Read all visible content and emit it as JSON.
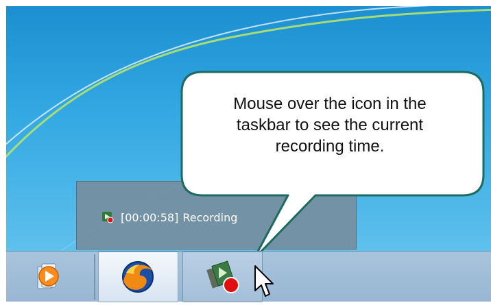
{
  "callout": {
    "line1": "Mouse over the icon in the",
    "line2": "taskbar to see the current",
    "line3": "recording time."
  },
  "thumbnail": {
    "time": "[00:00:58]",
    "status": "Recording"
  },
  "taskbar": {
    "buttons": [
      {
        "name": "Windows Media Player",
        "icon": "media-player-icon"
      },
      {
        "name": "Firefox",
        "icon": "firefox-icon"
      },
      {
        "name": "Screen Recorder",
        "icon": "recorder-icon"
      }
    ]
  },
  "colors": {
    "desktop": "#34a9e3",
    "callout_fill": "#ffffff",
    "callout_border": "#1e6a5c",
    "taskbar": "#a9c4dc",
    "record_red": "#e01010"
  }
}
